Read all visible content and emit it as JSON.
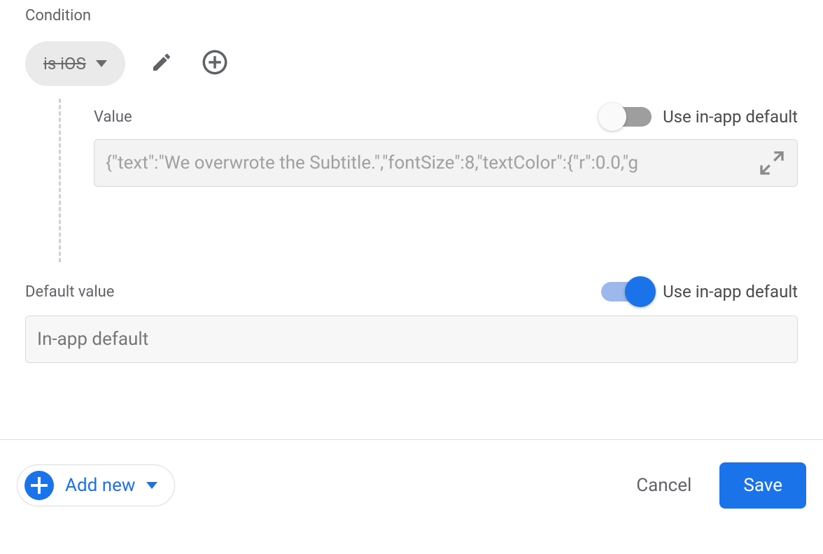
{
  "condition": {
    "section_label": "Condition",
    "chip_label": "is iOS",
    "toggle_label": "Use in-app default",
    "toggle_on": false,
    "value_label": "Value",
    "value_text": "{\"text\":\"We overwrote the Subtitle.\",\"fontSize\":8,\"textColor\":{\"r\":0.0,\"g"
  },
  "default": {
    "section_label": "Default value",
    "toggle_label": "Use in-app default",
    "toggle_on": true,
    "value_text": "In-app default"
  },
  "footer": {
    "add_new_label": "Add new",
    "cancel_label": "Cancel",
    "save_label": "Save"
  }
}
